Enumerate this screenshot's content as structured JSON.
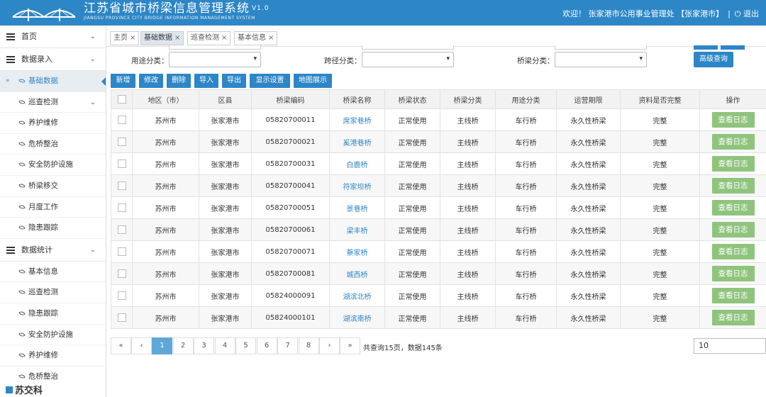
{
  "header": {
    "title": "江苏省城市桥梁信息管理系统",
    "version": "V1.0",
    "subtitle": "JIANGSU PROVINCE CITY BRIDGE INFORMATION MANAGEMENT SYSTEM",
    "welcome": "欢迎！ 张家港市公用事业管理处 【张家港市】",
    "separator": "|",
    "logout": "⏻ 退出"
  },
  "sidebar": {
    "top": [
      {
        "label": "首页"
      },
      {
        "label": "数据录入"
      },
      {
        "label": "数据统计"
      }
    ],
    "entry_items": [
      {
        "label": "基础数据"
      },
      {
        "label": "巡查检测"
      },
      {
        "label": "养护维修"
      },
      {
        "label": "危桥整治"
      },
      {
        "label": "安全防护设施"
      },
      {
        "label": "桥梁移交"
      },
      {
        "label": "月度工作"
      },
      {
        "label": "隐患跟踪"
      }
    ],
    "stat_items": [
      {
        "label": "基本信息"
      },
      {
        "label": "巡查检测"
      },
      {
        "label": "隐患跟踪"
      },
      {
        "label": "安全防护设施"
      },
      {
        "label": "养护维修"
      },
      {
        "label": "危桥整治"
      }
    ],
    "active_marker": "»",
    "chevron": "⌄",
    "bottom_logo": "苏交科"
  },
  "tabs": [
    {
      "label": "主页"
    },
    {
      "label": "基础数据"
    },
    {
      "label": "巡查检测"
    },
    {
      "label": "基本信息"
    }
  ],
  "tab_close": "×",
  "filters": {
    "use_label": "用途分类：",
    "span_label": "跨径分类：",
    "bridge_label": "桥梁分类：",
    "arrow": "▾",
    "advanced": "高级查询"
  },
  "toolbar": [
    "新增",
    "修改",
    "删除",
    "导入",
    "导出",
    "显示设置",
    "地图展示"
  ],
  "table": {
    "headers": [
      "地区（市）",
      "区县",
      "桥梁编码",
      "桥梁名称",
      "桥梁状态",
      "桥梁分类",
      "用途分类",
      "运营期限",
      "资料是否完整",
      "操作"
    ],
    "action_label": "查看日志",
    "rows": [
      [
        "苏州市",
        "张家港市",
        "05820700011",
        "席家巷桥",
        "正常使用",
        "主线桥",
        "车行桥",
        "永久性桥梁",
        "完整"
      ],
      [
        "苏州市",
        "张家港市",
        "05820700021",
        "奚港巷桥",
        "正常使用",
        "主线桥",
        "车行桥",
        "永久性桥梁",
        "完整"
      ],
      [
        "苏州市",
        "张家港市",
        "05820700031",
        "白鹿桥",
        "正常使用",
        "主线桥",
        "车行桥",
        "永久性桥梁",
        "完整"
      ],
      [
        "苏州市",
        "张家港市",
        "05820700041",
        "符家坝桥",
        "正常使用",
        "主线桥",
        "车行桥",
        "永久性桥梁",
        "完整"
      ],
      [
        "苏州市",
        "张家港市",
        "05820700051",
        "景巷桥",
        "正常使用",
        "主线桥",
        "车行桥",
        "永久性桥梁",
        "完整"
      ],
      [
        "苏州市",
        "张家港市",
        "05820700061",
        "梁丰桥",
        "正常使用",
        "主线桥",
        "车行桥",
        "永久性桥梁",
        "完整"
      ],
      [
        "苏州市",
        "张家港市",
        "05820700071",
        "蔡家桥",
        "正常使用",
        "主线桥",
        "车行桥",
        "永久性桥梁",
        "完整"
      ],
      [
        "苏州市",
        "张家港市",
        "05820700081",
        "城西桥",
        "正常使用",
        "主线桥",
        "车行桥",
        "永久性桥梁",
        "完整"
      ],
      [
        "苏州市",
        "张家港市",
        "05824000091",
        "湖滨北桥",
        "正常使用",
        "主线桥",
        "车行桥",
        "永久性桥梁",
        "完整"
      ],
      [
        "苏州市",
        "张家港市",
        "05824000101",
        "湖滨南桥",
        "正常使用",
        "主线桥",
        "车行桥",
        "永久性桥梁",
        "完整"
      ]
    ]
  },
  "pager": {
    "first": "«",
    "prev": "‹",
    "pages": [
      "1",
      "2",
      "3",
      "4",
      "5",
      "6",
      "7",
      "8"
    ],
    "current": 1,
    "next": "›",
    "last": "»",
    "info": "共查询15页，数据145条",
    "page_size": "10"
  },
  "colors": {
    "brand": "#2d86c6",
    "action_green": "#8fc47c",
    "active_page": "#5fa7d8"
  }
}
